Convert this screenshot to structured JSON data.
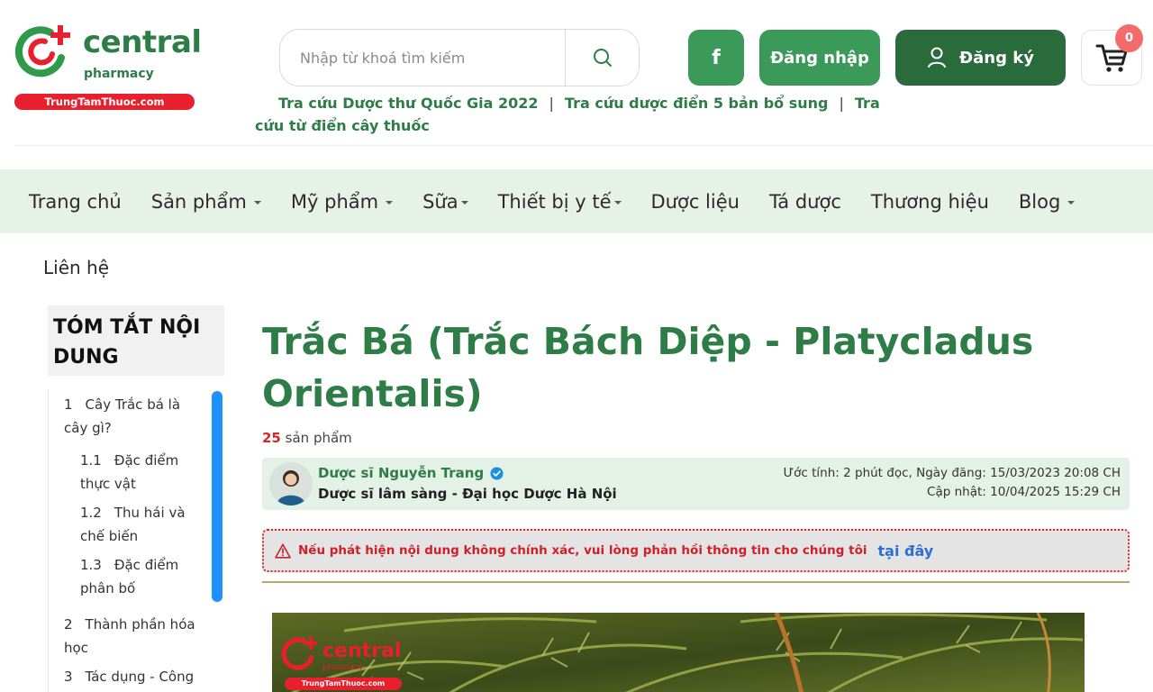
{
  "header": {
    "logo": {
      "name": "central",
      "sub": "pharmacy",
      "band": "TrungTamThuoc.com"
    },
    "search": {
      "placeholder": "Nhập từ khoá tìm kiếm"
    },
    "facebook_label": "f",
    "login_label": "Đăng nhập",
    "register_label": "Đăng ký",
    "cart_count": "0",
    "quicklinks": [
      "Tra cứu Dược thư Quốc Gia 2022",
      "Tra cứu dược điển 5 bản bổ sung",
      "Tra cứu từ điển cây thuốc"
    ],
    "separator": "|"
  },
  "nav": {
    "items": [
      {
        "label": "Trang chủ"
      },
      {
        "label": "Sản phẩm"
      },
      {
        "label": "Mỹ phẩm"
      },
      {
        "label": "Sữa"
      },
      {
        "label": "Thiết bị y tế"
      },
      {
        "label": "Dược liệu"
      },
      {
        "label": "Tá dược"
      },
      {
        "label": "Thương hiệu"
      },
      {
        "label": "Blog"
      }
    ],
    "contact": "Liên hệ"
  },
  "toc": {
    "title": "TÓM TẮT NỘI DUNG",
    "items": [
      {
        "num": "1",
        "label": "Cây Trắc bá là cây gì?"
      },
      {
        "num": "1.1",
        "label": "Đặc điểm thực vật"
      },
      {
        "num": "1.2",
        "label": "Thu hái và chế biến"
      },
      {
        "num": "1.3",
        "label": "Đặc điểm phân bố"
      },
      {
        "num": "2",
        "label": "Thành phần hóa học"
      },
      {
        "num": "3",
        "label": "Tác dụng - Công"
      }
    ]
  },
  "article": {
    "title": "Trắc Bá (Trắc Bách Diệp - Platycladus Orientalis)",
    "product_count": "25",
    "product_label": "sản phẩm",
    "author": {
      "name": "Dược sĩ Nguyễn Trang",
      "role": "Dược sĩ lâm sàng - Đại học Dược Hà Nội",
      "meta_line1": "Ước tính: 2 phút đọc, Ngày đăng: 15/03/2023 20:08 CH",
      "meta_line2": "Cập nhật: 10/04/2025 15:29 CH"
    },
    "alert": {
      "text": "Nếu phát hiện nội dung không chính xác, vui lòng phản hồi thông tin cho chúng tôi",
      "link": "tại đây"
    },
    "hero_watermark": {
      "name": "central",
      "sub": "pharmacy",
      "band": "TrungTamThuoc.com"
    }
  },
  "colors": {
    "brand_green": "#2e7d47",
    "button_green": "#3b9a5a",
    "register_green": "#2a6b3c",
    "nav_bg": "#e6f2e8",
    "alert_red": "#d0202a",
    "link_blue": "#2d6fd6"
  }
}
